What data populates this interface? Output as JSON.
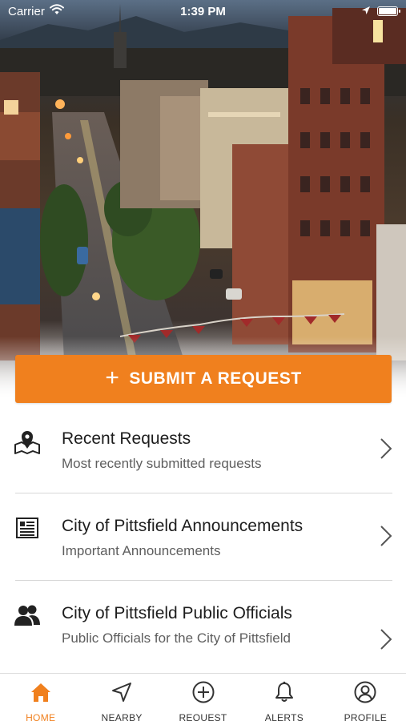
{
  "status_bar": {
    "carrier": "Carrier",
    "time": "1:39 PM"
  },
  "submit_button": {
    "label": "SUBMIT A REQUEST"
  },
  "list": {
    "items": [
      {
        "title": "Recent Requests",
        "subtitle": "Most recently submitted requests",
        "icon": "map-pin-icon"
      },
      {
        "title": "City of Pittsfield Announcements",
        "subtitle": "Important Announcements",
        "icon": "newspaper-icon"
      },
      {
        "title": "City of Pittsfield Public Officials",
        "subtitle": "Public Officials for the City of Pittsfield",
        "icon": "people-icon"
      }
    ]
  },
  "tab_bar": {
    "active": "HOME",
    "tabs": [
      {
        "label": "HOME",
        "icon": "home-icon"
      },
      {
        "label": "NEARBY",
        "icon": "navigation-arrow-icon"
      },
      {
        "label": "REQUEST",
        "icon": "plus-circle-icon"
      },
      {
        "label": "ALERTS",
        "icon": "bell-icon"
      },
      {
        "label": "PROFILE",
        "icon": "user-circle-icon"
      }
    ]
  },
  "colors": {
    "accent": "#f0801e",
    "text": "#1d1d1d",
    "subtext": "#5e5e5e"
  }
}
